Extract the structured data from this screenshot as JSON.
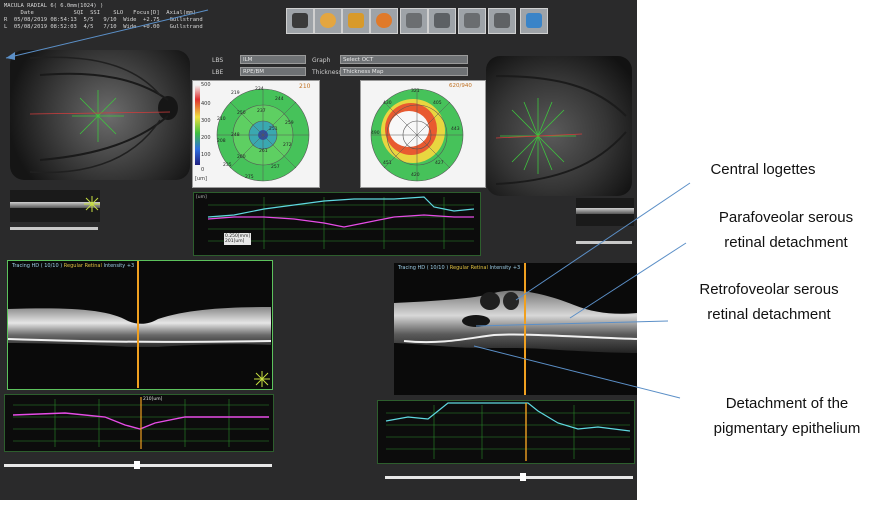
{
  "header": {
    "scan_title": "MACULA RADIAL 6( 6.0mm(1024) )",
    "columns": "     Date            SQI  SSI    SLO   Focus[D]  Axial(mm)",
    "rows": [
      "R  05/08/2019 08:54:13  5/5   9/10  Wide  +2.75   Gullstrand",
      "L  05/08/2019 08:52:03  4/5   7/10  Wide  +0.00   Gullstrand"
    ]
  },
  "toolbar": {
    "icons": [
      "monitor-icon",
      "face-icon",
      "report-r-icon",
      "color-map-icon",
      "print-icon",
      "save-icon",
      "export-icon",
      "exit-icon",
      "help-icon"
    ]
  },
  "controls": {
    "lbs_label": "LBS",
    "lbs_value": "ILM",
    "lbe_label": "LBE",
    "lbe_value": "RPE/BM",
    "graph_label": "Graph",
    "graph_value": "Select OCT",
    "thickness_label": "Thickness",
    "thickness_value": "Thickness Map"
  },
  "thickness_maps": {
    "left_corner": "210",
    "right_corner": "620/940",
    "scale_unit": "[um]",
    "scale_ticks": [
      "500",
      "400",
      "300",
      "200",
      "100",
      "0"
    ],
    "left_numbers": [
      "234",
      "244",
      "259",
      "272",
      "257",
      "275",
      "235",
      "208",
      "210",
      "219",
      "237",
      "251",
      "261",
      "260",
      "248",
      "250"
    ],
    "right_numbers": [
      "321",
      "405",
      "443",
      "427",
      "420",
      "451",
      "490",
      "430"
    ]
  },
  "graph_mid": {
    "tooltip_1": "0.250[mm]",
    "tooltip_2": "201[um]",
    "unit": "[um]"
  },
  "oct_left": {
    "title_a": "Tracing HD ( 10/10 )",
    "title_b": "Regular Retinal",
    "title_c": "Intensity +3"
  },
  "oct_right": {
    "title_a": "Tracing HD ( 10/10 )",
    "title_b": "Regular Retinal",
    "title_c": "Intensity +3"
  },
  "graph_bottom_left": {
    "marker": "210[um]"
  },
  "annotations": {
    "central_logettes": "Central logettes",
    "parafoveolar_1": "Parafoveolar serous",
    "parafoveolar_2": "retinal detachment",
    "retrofoveolar_1": "Retrofoveolar serous",
    "retrofoveolar_2": "retinal detachment",
    "pigmentary_1": "Detachment of the",
    "pigmentary_2": "pigmentary epithelium"
  },
  "colors": {
    "pointer_line": "#5b8fc7",
    "magenta_line": "#e64ce6",
    "cyan_line": "#5fd8e0",
    "green_grid": "#38b838",
    "orange_cursor": "#f0a020"
  }
}
